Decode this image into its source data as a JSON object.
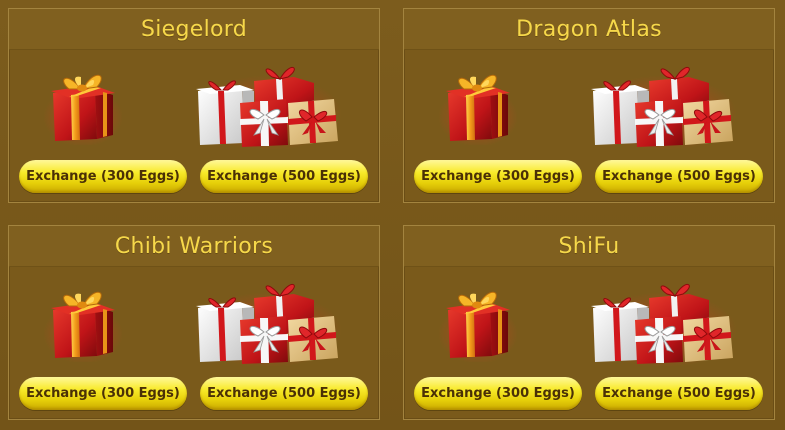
{
  "panels": [
    {
      "title": "Siegelord",
      "buttons": [
        "Exchange (300 Eggs)",
        "Exchange (500 Eggs)"
      ]
    },
    {
      "title": "Dragon Atlas",
      "buttons": [
        "Exchange (300 Eggs)",
        "Exchange (500 Eggs)"
      ]
    },
    {
      "title": "Chibi Warriors",
      "buttons": [
        "Exchange (300 Eggs)",
        "Exchange (500 Eggs)"
      ]
    },
    {
      "title": "ShiFu",
      "buttons": [
        "Exchange (300 Eggs)",
        "Exchange (500 Eggs)"
      ]
    }
  ],
  "icons": {
    "single": "gift-box-icon",
    "stack": "gift-stack-icon"
  },
  "colors": {
    "background": "#7a5a1c",
    "title": "#f6d84a",
    "button": "#f5e320",
    "button_text": "#4a3006",
    "gift_red": "#c8151b",
    "ribbon_gold": "#f2b51e"
  }
}
